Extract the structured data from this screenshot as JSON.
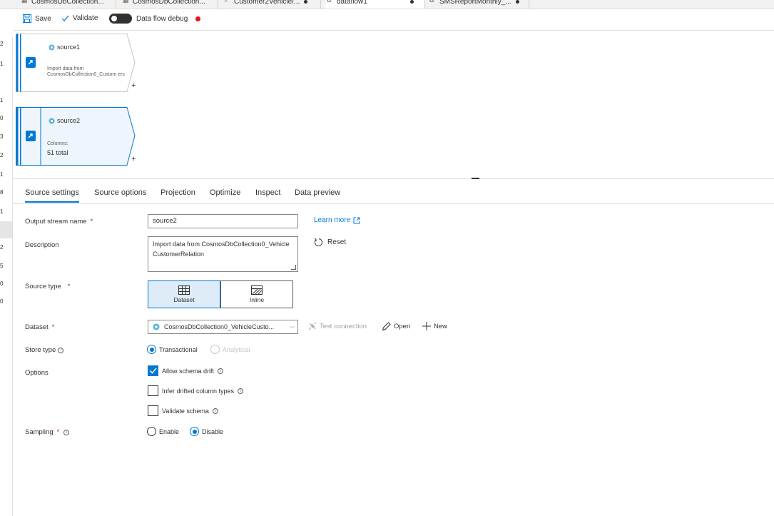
{
  "tabs": [
    {
      "label": "CosmosDbCollection...",
      "icon": "table-icon",
      "dirty": false,
      "active": false
    },
    {
      "label": "CosmosDbCollection...",
      "icon": "table-icon",
      "dirty": false,
      "active": false
    },
    {
      "label": "Customer2Vehicle/...",
      "icon": "pipeline-icon",
      "dirty": true,
      "active": false
    },
    {
      "label": "dataflow1",
      "icon": "dataflow-icon",
      "dirty": true,
      "active": true
    },
    {
      "label": "SMSReportMonthly_...",
      "icon": "dataflow-icon",
      "dirty": true,
      "active": false
    }
  ],
  "toolbar": {
    "save_label": "Save",
    "validate_label": "Validate",
    "debug_label": "Data flow debug",
    "debug_on": false,
    "debug_status_color": "#e81123"
  },
  "gutter": [
    "2",
    "1",
    "1",
    "0",
    "3",
    "2",
    "1",
    "8",
    "1",
    "2",
    "5",
    "0",
    "0"
  ],
  "nodes": {
    "source1": {
      "title": "source1",
      "description": "Import data from CosmosDbCollection0_Custom ers",
      "add": "+"
    },
    "source2": {
      "title": "source2",
      "columns_label": "Columns:",
      "columns_value": "51 total",
      "add": "+"
    }
  },
  "panel_tabs": [
    "Source settings",
    "Source options",
    "Projection",
    "Optimize",
    "Inspect",
    "Data preview"
  ],
  "form": {
    "required_mark": "*",
    "output_stream_label": "Output stream name",
    "output_stream_value": "source2",
    "learn_more": "Learn more",
    "description_label": "Description",
    "description_value": "Import data from CosmosDbCollection0_VehicleCustomerRelation",
    "reset_label": "Reset",
    "source_type_label": "Source type",
    "source_type_options": [
      "Dataset",
      "Inline"
    ],
    "source_type_selected": "Dataset",
    "dataset_label": "Dataset",
    "dataset_value": "CosmosDbCollection0_VehicleCusto...",
    "test_connection": "Test connection",
    "open_label": "Open",
    "new_label": "New",
    "store_type_label": "Store type",
    "store_transactional": "Transactional",
    "store_analytical": "Analytical",
    "options_label": "Options",
    "allow_schema_drift": "Allow schema drift",
    "allow_schema_drift_checked": true,
    "infer_drifted": "Infer drifted column types",
    "infer_drifted_checked": false,
    "validate_schema": "Validate schema",
    "validate_schema_checked": false,
    "sampling_label": "Sampling",
    "sampling_enable": "Enable",
    "sampling_disable": "Disable",
    "sampling_selected": "Disable"
  },
  "colors": {
    "accent": "#0078d4",
    "selected_node": "#eef5fc"
  }
}
